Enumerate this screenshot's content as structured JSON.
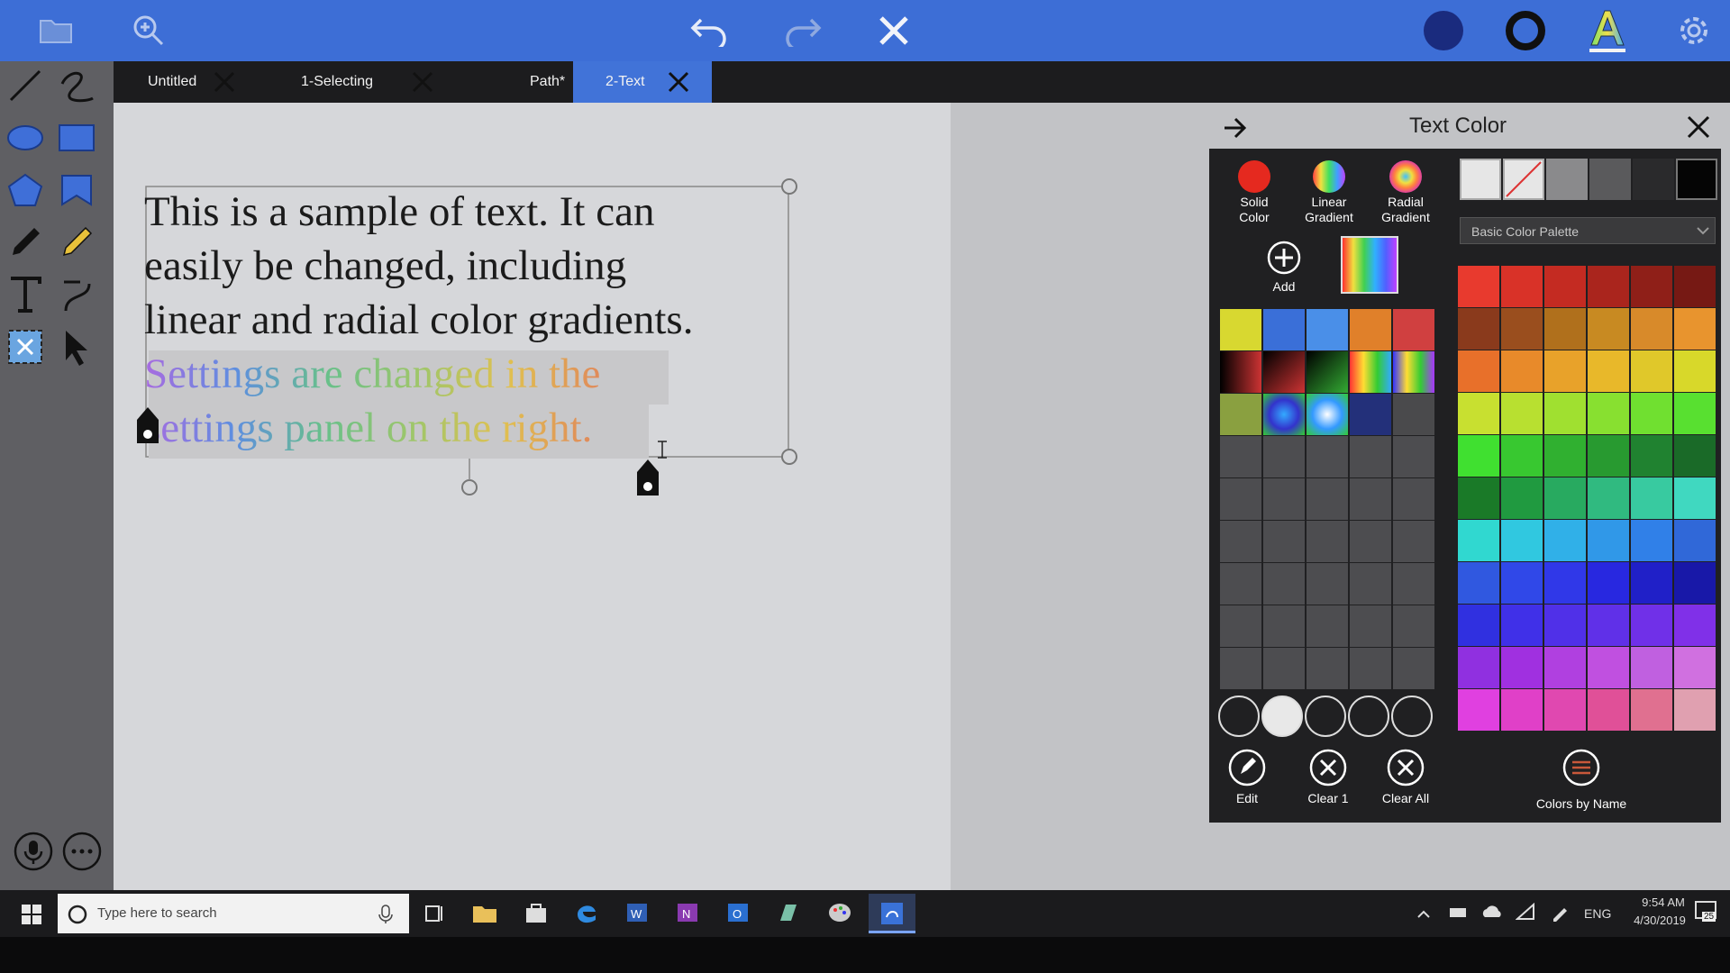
{
  "tabs": [
    {
      "label": "Untitled"
    },
    {
      "label": "1-Selecting"
    },
    {
      "label": "Path*"
    },
    {
      "label": "2-Text"
    }
  ],
  "canvas": {
    "line1": "This is a sample of text. It can",
    "line2": "easily be  changed, including",
    "line3": "linear and radial color gradients.",
    "line4": "Settings are changed in the",
    "line5": "settings panel on the right."
  },
  "panel": {
    "title": "Text Color",
    "modes": [
      {
        "label": "Solid Color"
      },
      {
        "label": "Linear Gradient"
      },
      {
        "label": "Radial Gradient"
      }
    ],
    "add_label": "Add",
    "palette_select": "Basic Color Palette",
    "edit_label": "Edit",
    "clear1_label": "Clear 1",
    "clearall_label": "Clear All",
    "colors_by_name_label": "Colors by Name"
  },
  "taskbar": {
    "search_placeholder": "Type here to search",
    "lang": "ENG",
    "time": "9:54 AM",
    "date": "4/30/2019",
    "notifications": "25"
  },
  "colors": {
    "accent": "#3d6ed6",
    "tab_active": "#4173d8",
    "panel_bg": "#202022"
  }
}
